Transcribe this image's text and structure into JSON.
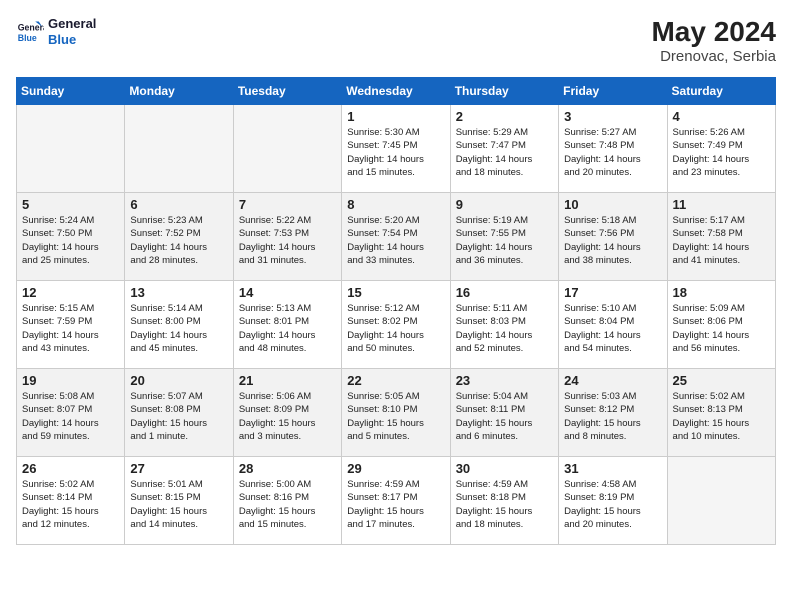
{
  "header": {
    "logo_general": "General",
    "logo_blue": "Blue",
    "month_year": "May 2024",
    "location": "Drenovac, Serbia"
  },
  "days_of_week": [
    "Sunday",
    "Monday",
    "Tuesday",
    "Wednesday",
    "Thursday",
    "Friday",
    "Saturday"
  ],
  "weeks": [
    [
      {
        "day": "",
        "info": ""
      },
      {
        "day": "",
        "info": ""
      },
      {
        "day": "",
        "info": ""
      },
      {
        "day": "1",
        "info": "Sunrise: 5:30 AM\nSunset: 7:45 PM\nDaylight: 14 hours\nand 15 minutes."
      },
      {
        "day": "2",
        "info": "Sunrise: 5:29 AM\nSunset: 7:47 PM\nDaylight: 14 hours\nand 18 minutes."
      },
      {
        "day": "3",
        "info": "Sunrise: 5:27 AM\nSunset: 7:48 PM\nDaylight: 14 hours\nand 20 minutes."
      },
      {
        "day": "4",
        "info": "Sunrise: 5:26 AM\nSunset: 7:49 PM\nDaylight: 14 hours\nand 23 minutes."
      }
    ],
    [
      {
        "day": "5",
        "info": "Sunrise: 5:24 AM\nSunset: 7:50 PM\nDaylight: 14 hours\nand 25 minutes."
      },
      {
        "day": "6",
        "info": "Sunrise: 5:23 AM\nSunset: 7:52 PM\nDaylight: 14 hours\nand 28 minutes."
      },
      {
        "day": "7",
        "info": "Sunrise: 5:22 AM\nSunset: 7:53 PM\nDaylight: 14 hours\nand 31 minutes."
      },
      {
        "day": "8",
        "info": "Sunrise: 5:20 AM\nSunset: 7:54 PM\nDaylight: 14 hours\nand 33 minutes."
      },
      {
        "day": "9",
        "info": "Sunrise: 5:19 AM\nSunset: 7:55 PM\nDaylight: 14 hours\nand 36 minutes."
      },
      {
        "day": "10",
        "info": "Sunrise: 5:18 AM\nSunset: 7:56 PM\nDaylight: 14 hours\nand 38 minutes."
      },
      {
        "day": "11",
        "info": "Sunrise: 5:17 AM\nSunset: 7:58 PM\nDaylight: 14 hours\nand 41 minutes."
      }
    ],
    [
      {
        "day": "12",
        "info": "Sunrise: 5:15 AM\nSunset: 7:59 PM\nDaylight: 14 hours\nand 43 minutes."
      },
      {
        "day": "13",
        "info": "Sunrise: 5:14 AM\nSunset: 8:00 PM\nDaylight: 14 hours\nand 45 minutes."
      },
      {
        "day": "14",
        "info": "Sunrise: 5:13 AM\nSunset: 8:01 PM\nDaylight: 14 hours\nand 48 minutes."
      },
      {
        "day": "15",
        "info": "Sunrise: 5:12 AM\nSunset: 8:02 PM\nDaylight: 14 hours\nand 50 minutes."
      },
      {
        "day": "16",
        "info": "Sunrise: 5:11 AM\nSunset: 8:03 PM\nDaylight: 14 hours\nand 52 minutes."
      },
      {
        "day": "17",
        "info": "Sunrise: 5:10 AM\nSunset: 8:04 PM\nDaylight: 14 hours\nand 54 minutes."
      },
      {
        "day": "18",
        "info": "Sunrise: 5:09 AM\nSunset: 8:06 PM\nDaylight: 14 hours\nand 56 minutes."
      }
    ],
    [
      {
        "day": "19",
        "info": "Sunrise: 5:08 AM\nSunset: 8:07 PM\nDaylight: 14 hours\nand 59 minutes."
      },
      {
        "day": "20",
        "info": "Sunrise: 5:07 AM\nSunset: 8:08 PM\nDaylight: 15 hours\nand 1 minute."
      },
      {
        "day": "21",
        "info": "Sunrise: 5:06 AM\nSunset: 8:09 PM\nDaylight: 15 hours\nand 3 minutes."
      },
      {
        "day": "22",
        "info": "Sunrise: 5:05 AM\nSunset: 8:10 PM\nDaylight: 15 hours\nand 5 minutes."
      },
      {
        "day": "23",
        "info": "Sunrise: 5:04 AM\nSunset: 8:11 PM\nDaylight: 15 hours\nand 6 minutes."
      },
      {
        "day": "24",
        "info": "Sunrise: 5:03 AM\nSunset: 8:12 PM\nDaylight: 15 hours\nand 8 minutes."
      },
      {
        "day": "25",
        "info": "Sunrise: 5:02 AM\nSunset: 8:13 PM\nDaylight: 15 hours\nand 10 minutes."
      }
    ],
    [
      {
        "day": "26",
        "info": "Sunrise: 5:02 AM\nSunset: 8:14 PM\nDaylight: 15 hours\nand 12 minutes."
      },
      {
        "day": "27",
        "info": "Sunrise: 5:01 AM\nSunset: 8:15 PM\nDaylight: 15 hours\nand 14 minutes."
      },
      {
        "day": "28",
        "info": "Sunrise: 5:00 AM\nSunset: 8:16 PM\nDaylight: 15 hours\nand 15 minutes."
      },
      {
        "day": "29",
        "info": "Sunrise: 4:59 AM\nSunset: 8:17 PM\nDaylight: 15 hours\nand 17 minutes."
      },
      {
        "day": "30",
        "info": "Sunrise: 4:59 AM\nSunset: 8:18 PM\nDaylight: 15 hours\nand 18 minutes."
      },
      {
        "day": "31",
        "info": "Sunrise: 4:58 AM\nSunset: 8:19 PM\nDaylight: 15 hours\nand 20 minutes."
      },
      {
        "day": "",
        "info": ""
      }
    ]
  ]
}
